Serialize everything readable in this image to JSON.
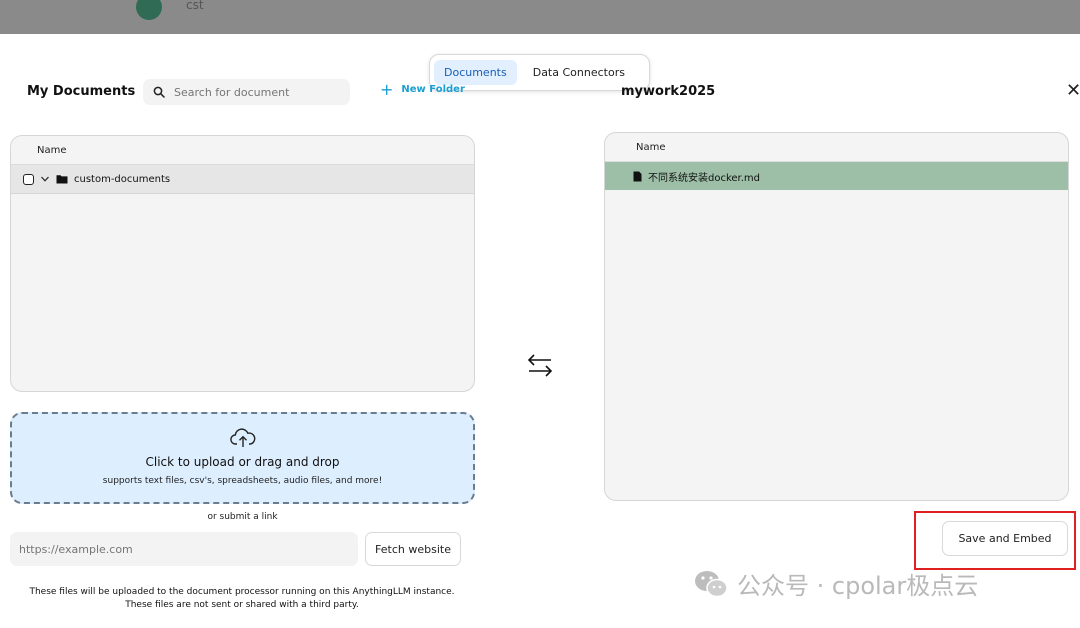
{
  "background": {
    "user_name": "cst"
  },
  "tabs": [
    {
      "label": "Documents",
      "active": true
    },
    {
      "label": "Data Connectors",
      "active": false
    }
  ],
  "left": {
    "title": "My Documents",
    "search_placeholder": "Search for document",
    "new_folder_label": "New Folder",
    "table": {
      "column_name": "Name",
      "rows": [
        {
          "type": "folder",
          "name": "custom-documents"
        }
      ]
    },
    "upload": {
      "main": "Click to upload or drag and drop",
      "sub": "supports text files, csv's, spreadsheets, audio files, and more!"
    },
    "or_link": "or submit a link",
    "url_placeholder": "https://example.com",
    "fetch_label": "Fetch website",
    "note_line1": "These files will be uploaded to the document processor running on this AnythingLLM instance.",
    "note_line2": "These files are not sent or shared with a third party."
  },
  "right": {
    "title": "mywork2025",
    "table": {
      "column_name": "Name",
      "rows": [
        {
          "type": "file",
          "name": "不同系统安装docker.md"
        }
      ]
    },
    "save_label": "Save and Embed"
  },
  "watermark": "公众号 · cpolar极点云",
  "colors": {
    "accent": "#1a9ed4",
    "selected_row": "#9dbfa7",
    "dropzone": "#ddeeff",
    "highlight": "#e02020"
  },
  "icons": [
    "search-icon",
    "plus-icon",
    "chevron-down-icon",
    "folder-icon",
    "file-icon",
    "cloud-upload-icon",
    "swap-arrows-icon",
    "close-icon",
    "wechat-icon"
  ]
}
